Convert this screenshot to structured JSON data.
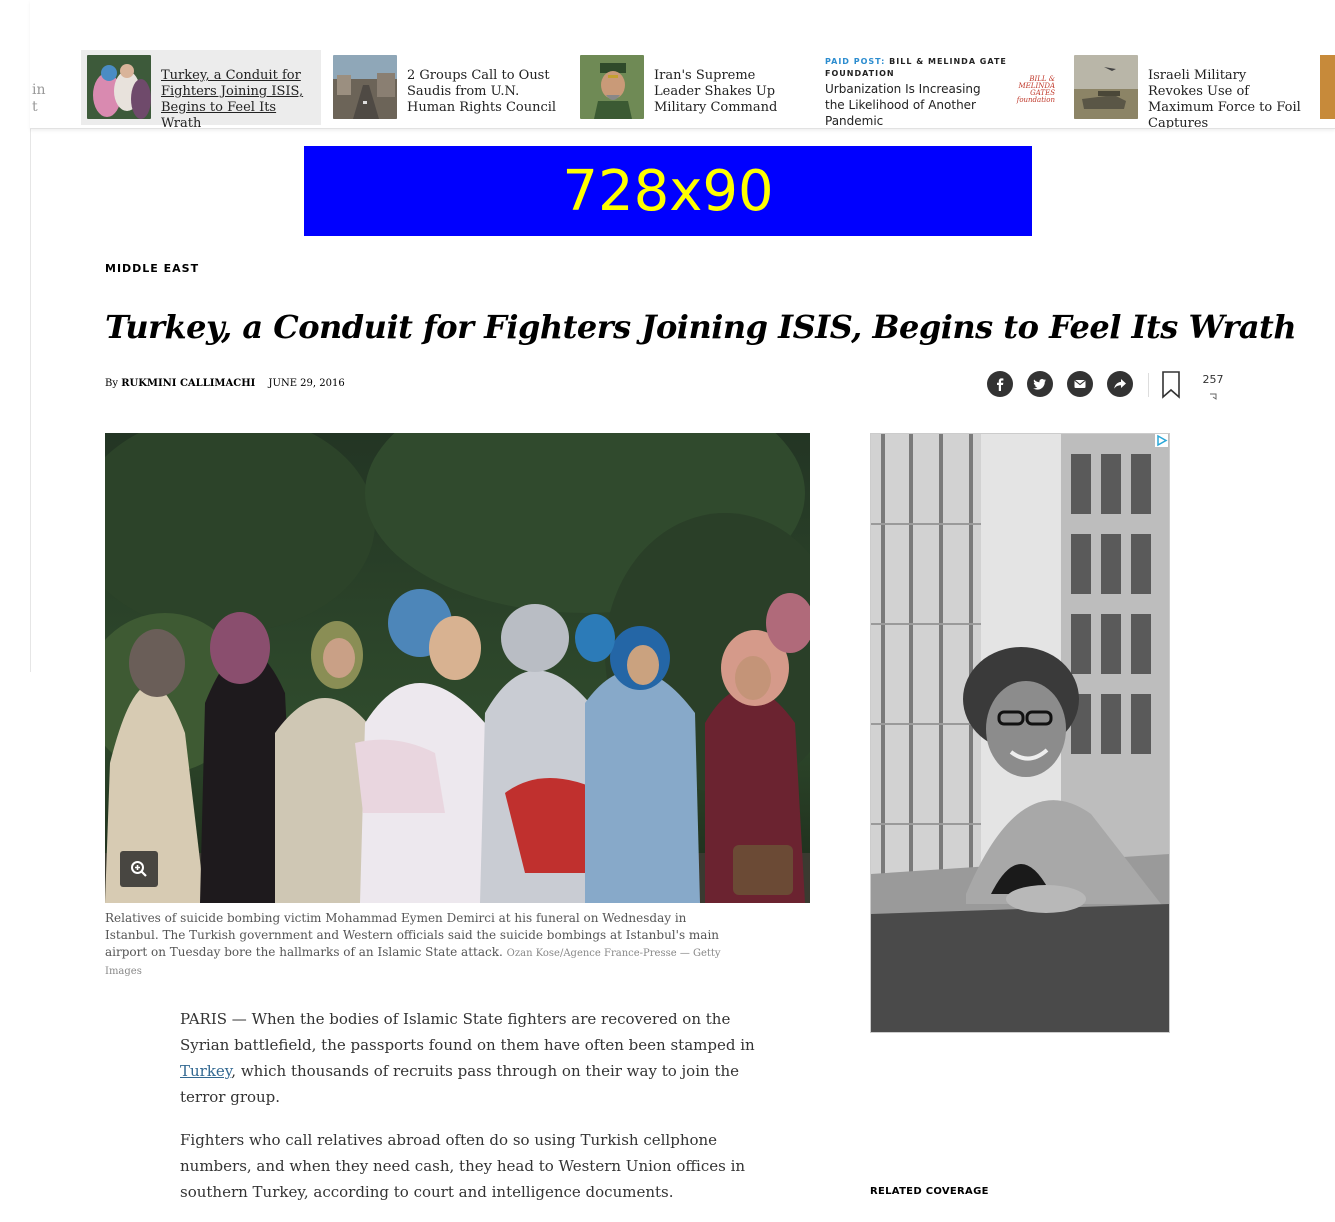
{
  "side_rail": {
    "stub_line1": "in",
    "stub_line2": "t"
  },
  "ribbon": {
    "items": [
      {
        "title": "Turkey, a Conduit for Fighters Joining ISIS, Begins to Feel Its Wrath",
        "active": true
      },
      {
        "title": "2 Groups Call to Oust Saudis from U.N. Human Rights Council"
      },
      {
        "title": "Iran's Supreme Leader Shakes Up Military Command"
      },
      {
        "title": "Israeli Military Revokes Use of Maximum Force to Foil Captures"
      }
    ],
    "paid_post": {
      "label_prefix": "PAID POST:",
      "sponsor": "BILL & MELINDA GATE FOUNDATION",
      "title": "Urbanization Is Increasing the Likelihood of Another Pandemic",
      "logo_text": "BILL & MELINDA GATES foundation"
    }
  },
  "leaderboard_ad": {
    "text": "728x90",
    "bg_color": "#0000ff",
    "text_color": "#ffff00"
  },
  "article": {
    "section": "MIDDLE EAST",
    "headline": "Turkey, a Conduit for Fighters Joining ISIS, Begins to Feel Its Wrath",
    "byline_prefix": "By",
    "author": "RUKMINI CALLIMACHI",
    "date": "JUNE 29, 2016",
    "comment_count": "257",
    "share_icons": [
      "facebook-icon",
      "twitter-icon",
      "email-icon",
      "share-icon"
    ],
    "caption": "Relatives of suicide bombing victim Mohammad Eymen Demirci at his funeral on Wednesday in Istanbul. The Turkish government and Western officials said the suicide bombings at Istanbul's main airport on Tuesday bore the hallmarks of an Islamic State attack.",
    "credit": "Ozan Kose/Agence France-Presse — Getty Images",
    "paragraphs": {
      "p1_start": "PARIS — When the bodies of Islamic State fighters are recovered on the Syrian battlefield, the passports found on them have often been stamped in ",
      "p1_link": "Turkey",
      "p1_end": ", which thousands of recruits pass through on their way to join the terror group.",
      "p2": "Fighters who call relatives abroad often do so using Turkish cellphone numbers, and when they need cash, they head to Western Union offices in southern Turkey, according to court and intelligence documents."
    },
    "link_color": "#326891"
  },
  "right_rail": {
    "related_label": "RELATED COVERAGE"
  }
}
